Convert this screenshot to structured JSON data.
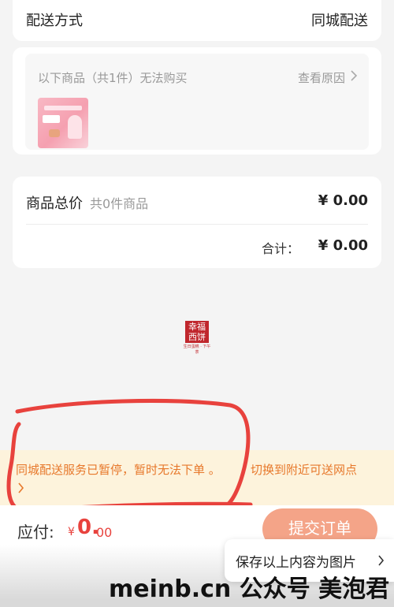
{
  "delivery": {
    "label": "配送方式",
    "value": "同城配送"
  },
  "unavailable": {
    "title": "以下商品（共1件）无法购买",
    "view_reason": "查看原因"
  },
  "total": {
    "label": "商品总价",
    "count": "共0件商品",
    "price": "¥ 0.00",
    "sum_label": "合计：",
    "sum_value": "¥ 0.00"
  },
  "brand": {
    "name_top": "幸福",
    "name_bottom": "西饼",
    "slogan": "生日蛋糕 · 下午茶"
  },
  "warning": {
    "text": "同城配送服务已暂停，暂时无法下单 。",
    "switch": "切换到附近可送网点"
  },
  "checkout": {
    "pay_label": "应付:",
    "currency": "¥",
    "amount_int": "0.",
    "amount_dec": "00",
    "submit": "提交订单"
  },
  "popup": {
    "save": "保存以上内容为图片"
  },
  "watermark": "meinb.cn 公众号 美泡君",
  "colors": {
    "accent": "#e8423d",
    "warning_text": "#e7782b",
    "warning_bg": "#fdf3dc",
    "submit_bg": "#f4a488",
    "annotation": "#e8423d"
  }
}
